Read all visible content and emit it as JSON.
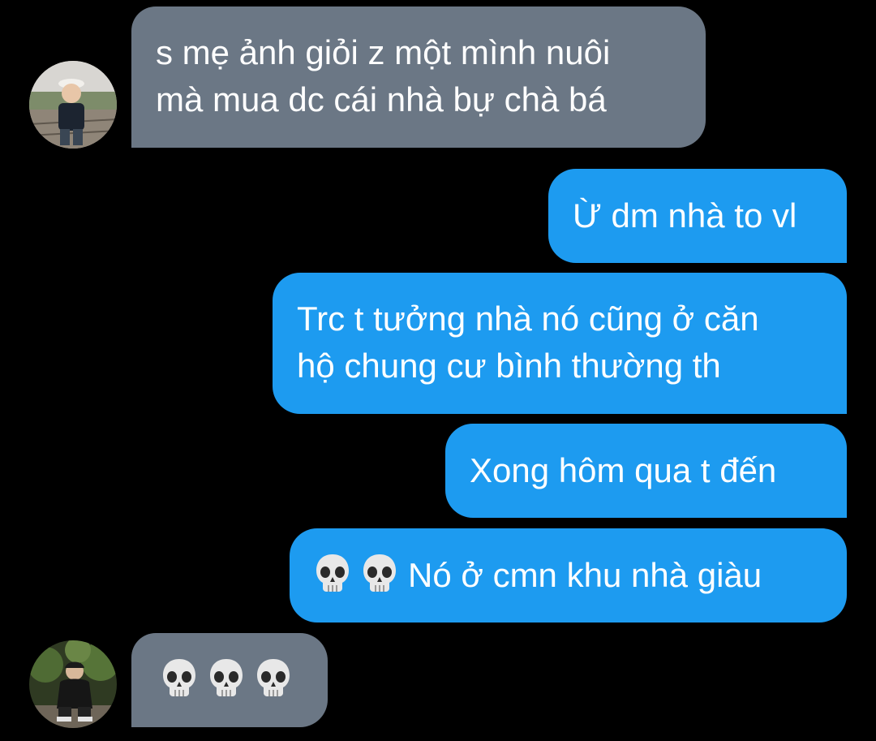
{
  "conversation": {
    "messages": [
      {
        "sender": "contact",
        "lines": [
          "s mẹ ảnh giỏi z một mình nuôi",
          "mà mua dc cái nhà bự chà bá"
        ]
      },
      {
        "sender": "me",
        "lines": [
          "Ừ dm nhà to vl"
        ]
      },
      {
        "sender": "me",
        "lines": [
          "Trc t tưởng nhà nó cũng ở căn",
          "hộ chung cư bình thường th"
        ]
      },
      {
        "sender": "me",
        "lines": [
          "Xong hôm qua t đến"
        ]
      },
      {
        "sender": "me",
        "emoji": [
          "💀",
          "💀"
        ],
        "text": "Nó ở cmn khu nhà giàu"
      },
      {
        "sender": "contact",
        "emoji": [
          "💀",
          "💀",
          "💀"
        ]
      }
    ]
  },
  "colors": {
    "background": "#000000",
    "incoming_bubble": "#6b7785",
    "outgoing_bubble": "#1d9bf0",
    "text": "#ffffff"
  },
  "icons": {
    "avatar_1": "avatar-child-photo",
    "avatar_2": "avatar-person-photo",
    "emoji": "skull-emoji"
  }
}
